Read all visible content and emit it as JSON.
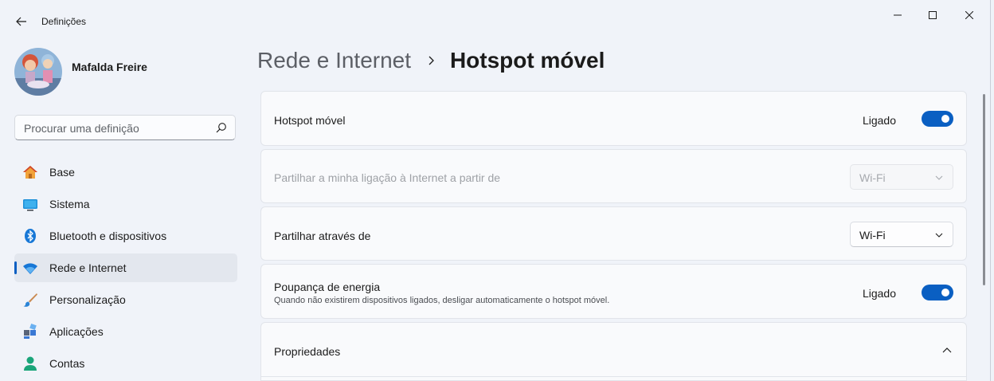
{
  "window": {
    "title": "Definições"
  },
  "user": {
    "name": "Mafalda Freire"
  },
  "search": {
    "placeholder": "Procurar uma definição"
  },
  "sidebar": {
    "items": [
      {
        "label": "Base",
        "icon": "home-icon",
        "active": false
      },
      {
        "label": "Sistema",
        "icon": "system-icon",
        "active": false
      },
      {
        "label": "Bluetooth e dispositivos",
        "icon": "bluetooth-icon",
        "active": false
      },
      {
        "label": "Rede e Internet",
        "icon": "wifi-icon",
        "active": true
      },
      {
        "label": "Personalização",
        "icon": "brush-icon",
        "active": false
      },
      {
        "label": "Aplicações",
        "icon": "apps-icon",
        "active": false
      },
      {
        "label": "Contas",
        "icon": "account-icon",
        "active": false
      }
    ]
  },
  "breadcrumb": {
    "parent": "Rede e Internet",
    "current": "Hotspot móvel"
  },
  "settings": {
    "hotspot": {
      "title": "Hotspot móvel",
      "state": "Ligado",
      "on": true
    },
    "share_from": {
      "title": "Partilhar a minha ligação à Internet a partir de",
      "value": "Wi-Fi",
      "disabled": true
    },
    "share_over": {
      "title": "Partilhar através de",
      "value": "Wi-Fi"
    },
    "power_saving": {
      "title": "Poupança de energia",
      "description": "Quando não existirem dispositivos ligados, desligar automaticamente o hotspot móvel.",
      "state": "Ligado",
      "on": true
    },
    "properties": {
      "title": "Propriedades",
      "expanded": true
    }
  },
  "colors": {
    "accent": "#0a5fc2",
    "background": "#f0f3f9",
    "card": "#f9fafc"
  }
}
